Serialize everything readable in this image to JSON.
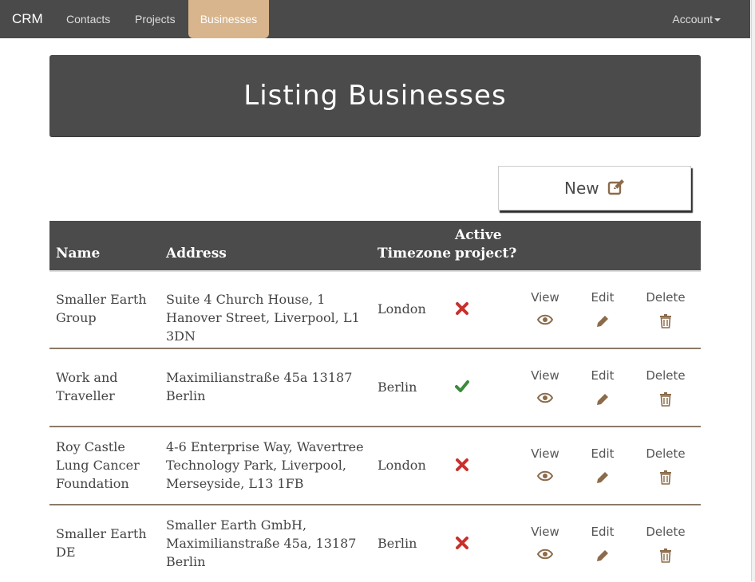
{
  "navbar": {
    "brand": "CRM",
    "links": [
      {
        "label": "Contacts"
      },
      {
        "label": "Projects"
      },
      {
        "label": "Businesses"
      }
    ],
    "account_label": "Account"
  },
  "header": {
    "title": "Listing Businesses"
  },
  "new_button": {
    "label": "New"
  },
  "table": {
    "columns": [
      "Name",
      "Address",
      "Timezone",
      "Active project?"
    ],
    "actions": {
      "view": "View",
      "edit": "Edit",
      "delete": "Delete"
    },
    "rows": [
      {
        "name": "Smaller Earth Group",
        "address": "Suite 4 Church House, 1 Hanover Street, Liverpool, L1 3DN",
        "timezone": "London",
        "active": false
      },
      {
        "name": "Work and Traveller",
        "address": "Maximilianstraße 45a 13187 Berlin",
        "timezone": "Berlin",
        "active": true
      },
      {
        "name": "Roy Castle Lung Cancer Foundation",
        "address": "4-6 Enterprise Way, Wavertree Technology Park, Liverpool, Merseyside, L13 1FB",
        "timezone": "London",
        "active": false
      },
      {
        "name": "Smaller Earth DE",
        "address": "Smaller Earth GmbH, Maximilianstraße 45a, 13187 Berlin",
        "timezone": "Berlin",
        "active": false
      }
    ]
  },
  "colors": {
    "navbar_bg": "#4a4a4a",
    "active_tab_bg": "#d8b58c",
    "header_bg": "#4b4b4b",
    "check_green": "#3c8a3c",
    "cross_red": "#c9302c",
    "icon_brown": "#8b6b4a"
  }
}
